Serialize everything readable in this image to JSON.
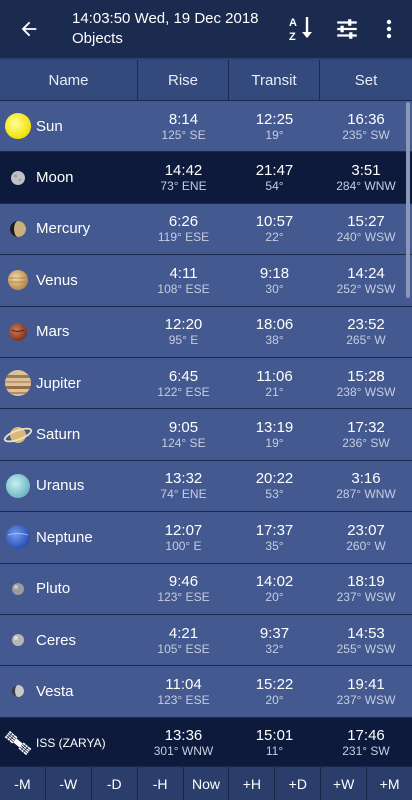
{
  "appbar": {
    "datetime": "14:03:50 Wed, 19 Dec 2018",
    "subtitle": "Objects",
    "icons": [
      "back-arrow-icon",
      "sort-az-icon",
      "filter-sliders-icon",
      "more-vert-icon"
    ]
  },
  "columns": [
    "Name",
    "Rise",
    "Transit",
    "Set"
  ],
  "rows": [
    {
      "name": "Sun",
      "icon": "sun-icon",
      "rise": "8:14",
      "rise_az": "125° SE",
      "transit": "12:25",
      "transit_alt": "19°",
      "set": "16:36",
      "set_az": "235° SW"
    },
    {
      "name": "Moon",
      "icon": "moon-icon",
      "rise": "14:42",
      "rise_az": "73° ENE",
      "transit": "21:47",
      "transit_alt": "54°",
      "set": "3:51",
      "set_az": "284° WNW"
    },
    {
      "name": "Mercury",
      "icon": "mercury-icon",
      "rise": "6:26",
      "rise_az": "119° ESE",
      "transit": "10:57",
      "transit_alt": "22°",
      "set": "15:27",
      "set_az": "240° WSW"
    },
    {
      "name": "Venus",
      "icon": "venus-icon",
      "rise": "4:11",
      "rise_az": "108° ESE",
      "transit": "9:18",
      "transit_alt": "30°",
      "set": "14:24",
      "set_az": "252° WSW"
    },
    {
      "name": "Mars",
      "icon": "mars-icon",
      "rise": "12:20",
      "rise_az": "95° E",
      "transit": "18:06",
      "transit_alt": "38°",
      "set": "23:52",
      "set_az": "265° W"
    },
    {
      "name": "Jupiter",
      "icon": "jupiter-icon",
      "rise": "6:45",
      "rise_az": "122° ESE",
      "transit": "11:06",
      "transit_alt": "21°",
      "set": "15:28",
      "set_az": "238° WSW"
    },
    {
      "name": "Saturn",
      "icon": "saturn-icon",
      "rise": "9:05",
      "rise_az": "124° SE",
      "transit": "13:19",
      "transit_alt": "19°",
      "set": "17:32",
      "set_az": "236° SW"
    },
    {
      "name": "Uranus",
      "icon": "uranus-icon",
      "rise": "13:32",
      "rise_az": "74° ENE",
      "transit": "20:22",
      "transit_alt": "53°",
      "set": "3:16",
      "set_az": "287° WNW"
    },
    {
      "name": "Neptune",
      "icon": "neptune-icon",
      "rise": "12:07",
      "rise_az": "100° E",
      "transit": "17:37",
      "transit_alt": "35°",
      "set": "23:07",
      "set_az": "260° W"
    },
    {
      "name": "Pluto",
      "icon": "pluto-icon",
      "rise": "9:46",
      "rise_az": "123° ESE",
      "transit": "14:02",
      "transit_alt": "20°",
      "set": "18:19",
      "set_az": "237° WSW"
    },
    {
      "name": "Ceres",
      "icon": "ceres-icon",
      "rise": "4:21",
      "rise_az": "105° ESE",
      "transit": "9:37",
      "transit_alt": "32°",
      "set": "14:53",
      "set_az": "255° WSW"
    },
    {
      "name": "Vesta",
      "icon": "vesta-icon",
      "rise": "11:04",
      "rise_az": "123° ESE",
      "transit": "15:22",
      "transit_alt": "20°",
      "set": "19:41",
      "set_az": "237° WSW"
    },
    {
      "name": "ISS (ZARYA)",
      "icon": "satellite-icon",
      "rise": "13:36",
      "rise_az": "301° WNW",
      "transit": "15:01",
      "transit_alt": "11°",
      "set": "17:46",
      "set_az": "231° SW"
    }
  ],
  "time_buttons": [
    "-M",
    "-W",
    "-D",
    "-H",
    "Now",
    "+H",
    "+D",
    "+W",
    "+M"
  ]
}
